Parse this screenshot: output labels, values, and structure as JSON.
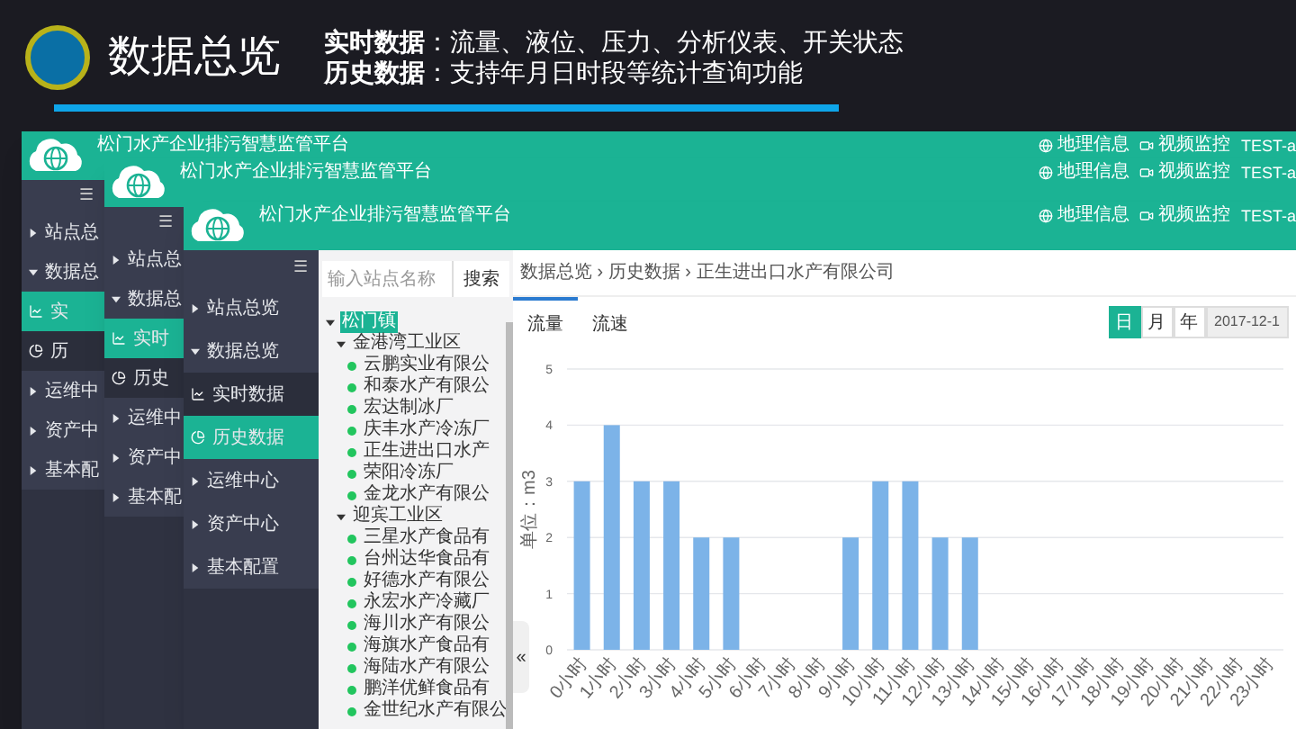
{
  "slide": {
    "title": "数据总览",
    "bullets": [
      "**实时数据**：流量、液位、压力、分析仪表、开关状态",
      "**历史数据**：支持年月日时段等统计查询功能"
    ]
  },
  "windows": [
    {
      "title": "松门水产企业排污智慧监管平台",
      "links": [
        "地理信息",
        "视频监控"
      ],
      "user": "TEST-a",
      "menu_toggle": "☰",
      "sidebar": [
        {
          "label": "站点总",
          "kind": "group",
          "expanded": false,
          "selected": false
        },
        {
          "label": "数据总",
          "kind": "group",
          "expanded": true,
          "selected": false
        },
        {
          "label": "实",
          "kind": "chart",
          "selected": true
        },
        {
          "label": "历",
          "kind": "pie",
          "selected": false
        },
        {
          "label": "运维中",
          "kind": "group",
          "expanded": false,
          "selected": false
        },
        {
          "label": "资产中",
          "kind": "group",
          "expanded": false,
          "selected": false
        },
        {
          "label": "基本配",
          "kind": "group",
          "expanded": false,
          "selected": false
        }
      ]
    },
    {
      "title": "松门水产企业排污智慧监管平台",
      "links": [
        "地理信息",
        "视频监控"
      ],
      "user": "TEST-a",
      "menu_toggle": "☰",
      "sidebar": [
        {
          "label": "站点总",
          "kind": "group",
          "expanded": false,
          "selected": false
        },
        {
          "label": "数据总",
          "kind": "group",
          "expanded": true,
          "selected": false
        },
        {
          "label": "实时",
          "kind": "chart",
          "selected": true
        },
        {
          "label": "历史",
          "kind": "pie",
          "selected": false
        },
        {
          "label": "运维中",
          "kind": "group",
          "expanded": false,
          "selected": false
        },
        {
          "label": "资产中",
          "kind": "group",
          "expanded": false,
          "selected": false
        },
        {
          "label": "基本配",
          "kind": "group",
          "expanded": false,
          "selected": false
        }
      ]
    },
    {
      "title": "松门水产企业排污智慧监管平台",
      "links": [
        "地理信息",
        "视频监控"
      ],
      "user": "TEST-a",
      "menu_toggle": "☰",
      "sidebar": [
        {
          "label": "站点总览",
          "kind": "group",
          "expanded": false,
          "selected": false
        },
        {
          "label": "数据总览",
          "kind": "group",
          "expanded": true,
          "selected": false
        },
        {
          "label": "实时数据",
          "kind": "chart",
          "selected": false
        },
        {
          "label": "历史数据",
          "kind": "pie",
          "selected": true
        },
        {
          "label": "运维中心",
          "kind": "group",
          "expanded": false,
          "selected": false
        },
        {
          "label": "资产中心",
          "kind": "group",
          "expanded": false,
          "selected": false
        },
        {
          "label": "基本配置",
          "kind": "group",
          "expanded": false,
          "selected": false
        }
      ],
      "tree": {
        "placeholder": "输入站点名称",
        "button": "搜索",
        "nodes": [
          {
            "label": "松门镇",
            "selected": true,
            "expanded": true,
            "children": [
              {
                "label": "金港湾工业区",
                "selected": false,
                "expanded": true,
                "children": [
                  {
                    "label": "云鹏实业有限公",
                    "selected": false
                  },
                  {
                    "label": "和泰水产有限公",
                    "selected": false
                  },
                  {
                    "label": "宏达制冰厂",
                    "selected": false
                  },
                  {
                    "label": "庆丰水产冷冻厂",
                    "selected": false
                  },
                  {
                    "label": "正生进出口水产",
                    "selected": false
                  },
                  {
                    "label": "荣阳冷冻厂",
                    "selected": false
                  },
                  {
                    "label": "金龙水产有限公",
                    "selected": false
                  }
                ]
              },
              {
                "label": "迎宾工业区",
                "selected": false,
                "expanded": true,
                "children": [
                  {
                    "label": "三星水产食品有",
                    "selected": false
                  },
                  {
                    "label": "台州达华食品有",
                    "selected": false
                  },
                  {
                    "label": "好德水产有限公",
                    "selected": false
                  },
                  {
                    "label": "永宏水产冷藏厂",
                    "selected": false
                  },
                  {
                    "label": "海川水产有限公",
                    "selected": false
                  },
                  {
                    "label": "海旗水产食品有",
                    "selected": false
                  },
                  {
                    "label": "海陆水产有限公",
                    "selected": false
                  },
                  {
                    "label": "鹏洋优鲜食品有",
                    "selected": false
                  },
                  {
                    "label": "金世纪水产有限公",
                    "selected": false
                  }
                ]
              }
            ]
          }
        ]
      },
      "content": {
        "breadcrumb": "数据总览 › 历史数据 › 正生进出口水产有限公司",
        "tabs": [
          {
            "label": "流量",
            "selected": true
          },
          {
            "label": "流速",
            "selected": false
          }
        ],
        "periods": [
          {
            "label": "日",
            "selected": true
          },
          {
            "label": "月",
            "selected": false
          },
          {
            "label": "年",
            "selected": false
          }
        ],
        "date": "2017-12-1",
        "collapse": "«",
        "chart_data": {
          "type": "bar",
          "ylabel": "单位：m3",
          "categories": [
            "0小时",
            "1小时",
            "2小时",
            "3小时",
            "4小时",
            "5小时",
            "6小时",
            "7小时",
            "8小时",
            "9小时",
            "10小时",
            "11小时",
            "12小时",
            "13小时",
            "14小时",
            "15小时",
            "16小时",
            "17小时",
            "18小时",
            "19小时",
            "20小时",
            "21小时",
            "22小时",
            "23小时"
          ],
          "values": [
            3,
            4,
            3,
            3,
            2,
            2,
            0,
            0,
            0,
            2,
            3,
            3,
            2,
            2,
            0,
            0,
            0,
            0,
            0,
            0,
            0,
            0,
            0,
            0
          ],
          "ylim": [
            0,
            5
          ],
          "yticks": [
            0,
            1,
            2,
            3,
            4,
            5
          ],
          "grid": true
        }
      }
    }
  ]
}
